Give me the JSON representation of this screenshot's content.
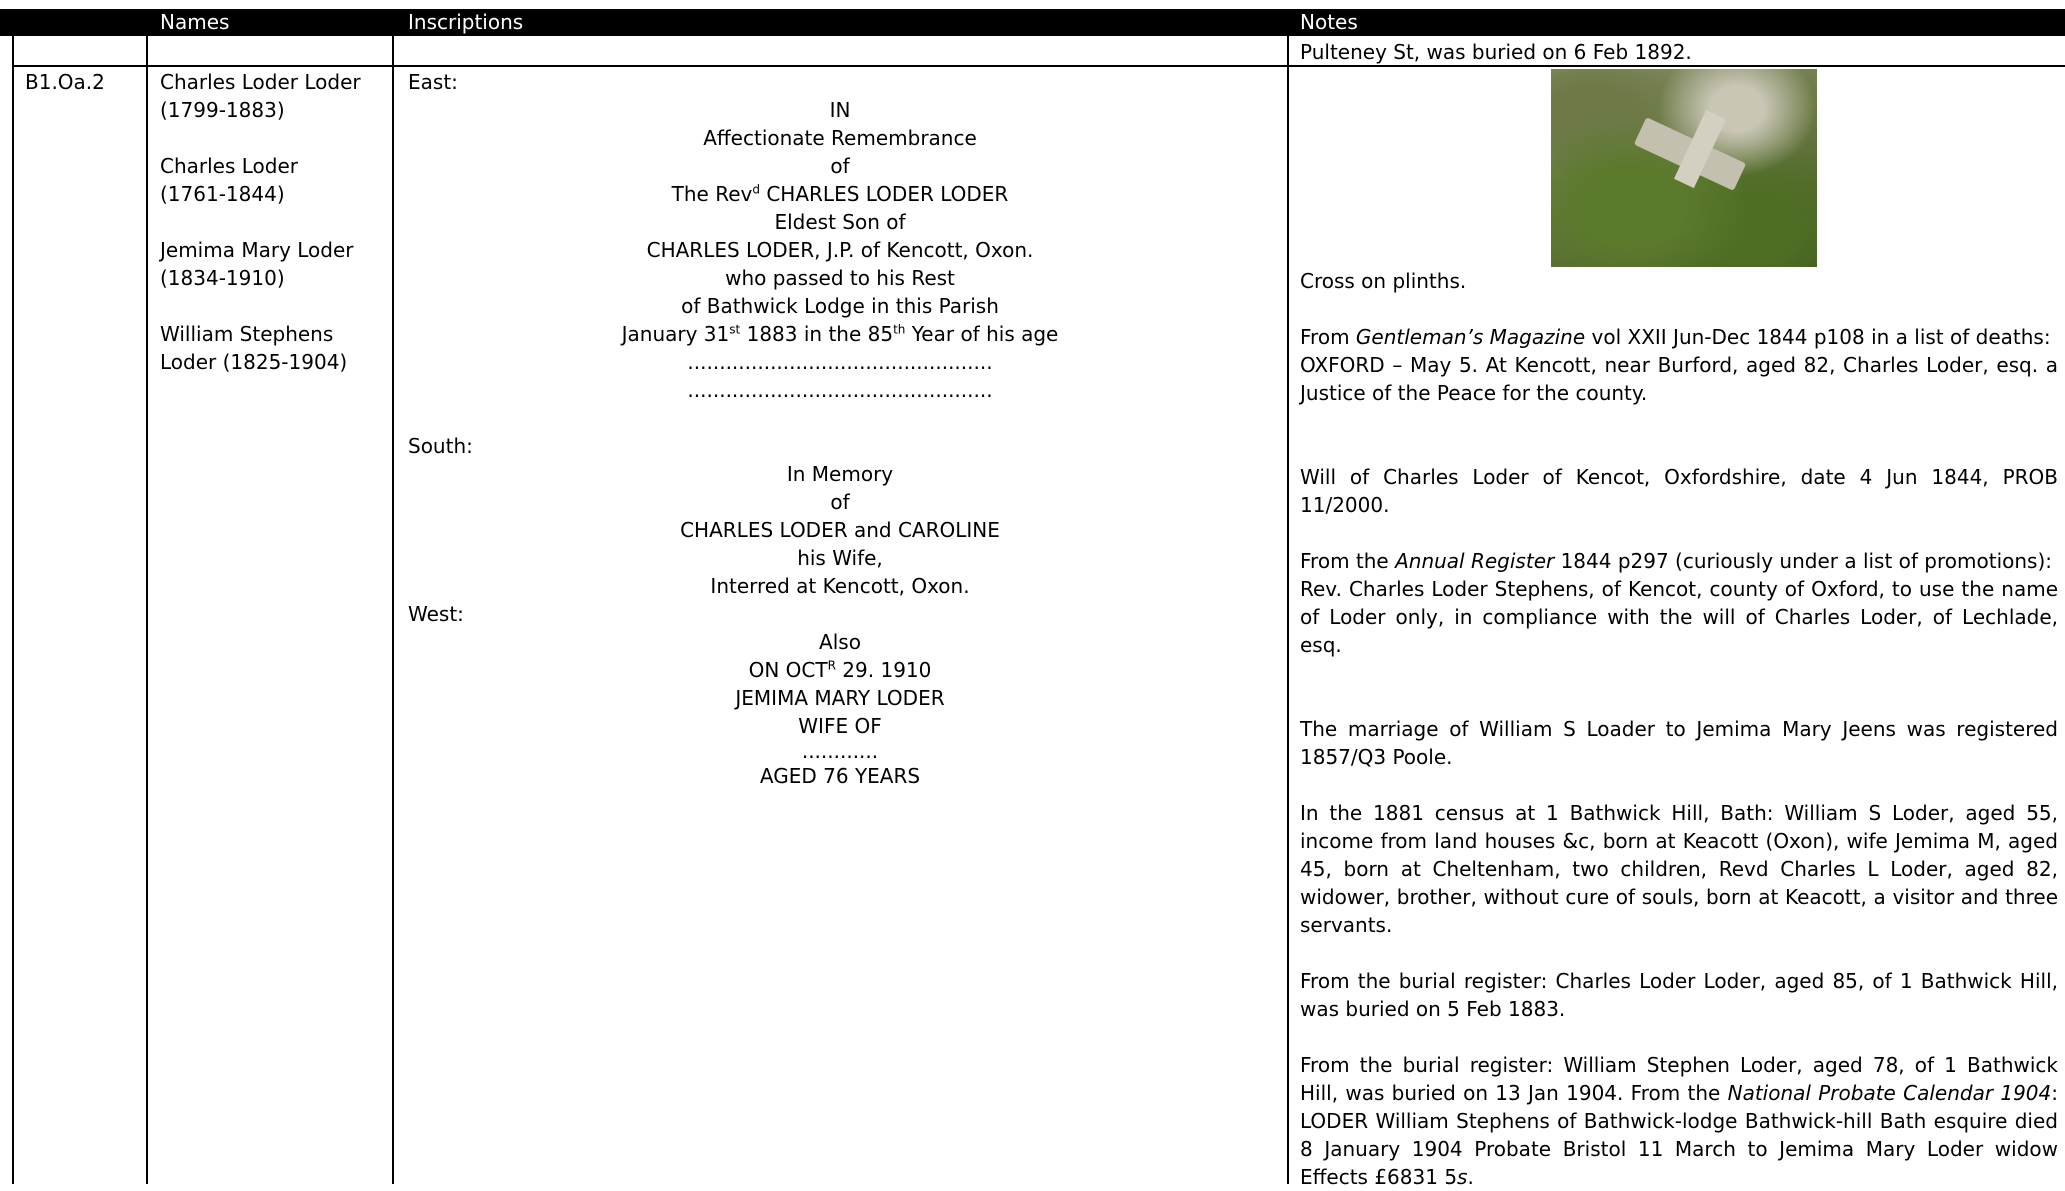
{
  "header": {
    "col_names": "Names",
    "col_inscriptions": "Inscriptions",
    "col_notes": "Notes"
  },
  "top_note": "Pulteney St, was buried on 6 Feb 1892.",
  "record": {
    "id": "B1.Oa.2",
    "names": [
      "Charles Loder Loder",
      "(1799-1883)",
      "Charles Loder",
      "(1761-1844)",
      "Jemima Mary Loder",
      "(1834-1910)",
      "William Stephens",
      "Loder (1825-1904)"
    ]
  },
  "inscriptions": {
    "east_label": "East:",
    "east": {
      "l1": "IN",
      "l2": "Affectionate Remembrance",
      "l3": "of",
      "l4a": "The Rev",
      "l4sup": "d",
      "l4b": " CHARLES LODER LODER",
      "l5": "Eldest Son of",
      "l6": "CHARLES LODER, J.P. of Kencott, Oxon.",
      "l7": "who passed to his Rest",
      "l8": "of Bathwick Lodge in this Parish",
      "l9a": "January 31",
      "l9sup1": "st",
      "l9b": " 1883 in the 85",
      "l9sup2": "th",
      "l9c": " Year of his age",
      "dots1": "................................................",
      "dots2": "................................................"
    },
    "south_label": "South:",
    "south": [
      "In Memory",
      "of",
      "CHARLES LODER and CAROLINE",
      "his Wife,",
      "Interred at Kencott, Oxon."
    ],
    "west_label": "West:",
    "west": {
      "l1": "Also",
      "l2a": "ON OCT",
      "l2sup": "R",
      "l2b": " 29. 1910",
      "l3": "JEMIMA MARY LODER",
      "l4": "WIFE OF",
      "l5": "............",
      "l6": "AGED 76 YEARS"
    }
  },
  "notes": {
    "photo_caption": "Cross on plinths.",
    "p1_pre": "From ",
    "p1_em": "Gentleman’s Magazine",
    "p1_post": " vol XXII Jun-Dec 1844 p108 in a list of deaths:",
    "p1_line2": "OXFORD – May 5. At Kencott, near Burford, aged 82, Charles Loder, esq. a Justice of the Peace for the county.",
    "p2": "Will of Charles Loder of Kencot, Oxfordshire, date 4 Jun 1844, PROB 11/2000.",
    "p3_pre": "From the ",
    "p3_em": "Annual Register",
    "p3_post": " 1844 p297 (curiously under a list of promotions):",
    "p3_line2": "Rev. Charles Loder Stephens, of Kencot, county of Oxford, to use the name of Loder only, in compliance with the will of Charles Loder, of Lechlade, esq.",
    "p4": "The marriage of William S Loader to Jemima Mary Jeens was registered 1857/Q3 Poole.",
    "p5": "In the 1881 census at 1 Bathwick Hill, Bath: William S Loder, aged 55, income from land houses &c, born at Keacott (Oxon), wife Jemima M, aged 45, born at Cheltenham, two children, Revd Charles L Loder, aged 82, widower, brother, without cure of souls, born at Keacott, a visitor and three servants.",
    "p6": "From the burial register: Charles Loder Loder, aged 85, of 1 Bathwick Hill, was buried on 5 Feb 1883.",
    "p7_pre": "From the burial register: William Stephen Loder, aged 78, of 1 Bathwick Hill, was buried on 13 Jan 1904. From the ",
    "p7_em": "National Probate Calendar 1904",
    "p7_post": ": LODER William Stephens of Bathwick-lodge Bathwick-hill Bath esquire died 8 January 1904 Probate Bristol 11 March to Jemima Mary Loder widow Effects £6831 5",
    "p7_em2": "s",
    "p7_end": "."
  }
}
